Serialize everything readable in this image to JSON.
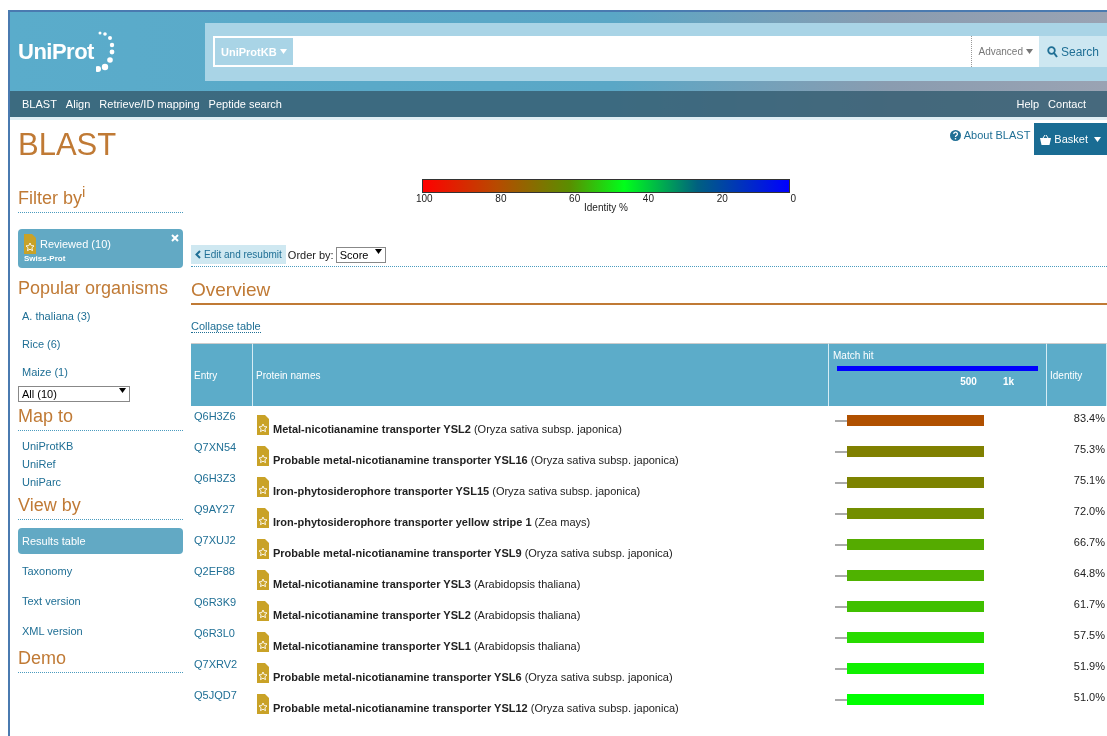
{
  "header": {
    "logo": "UniProt",
    "search": {
      "database": "UniProtKB",
      "advanced": "Advanced",
      "button": "Search"
    },
    "nav_left": [
      "BLAST",
      "Align",
      "Retrieve/ID mapping",
      "Peptide search"
    ],
    "nav_right": [
      "Help",
      "Contact"
    ]
  },
  "page_title": "BLAST",
  "about_link": "About BLAST",
  "basket": "Basket",
  "sidebar": {
    "filter_title": "Filter by$^{i}$",
    "active_filter": {
      "label": "Reviewed (10)",
      "sublabel": "Swiss-Prot"
    },
    "organisms_title": "Popular organisms",
    "organisms": [
      "A. thaliana (3)",
      "Rice (6)",
      "Maize (1)"
    ],
    "organism_select": "All (10)",
    "map_title": "Map to",
    "map_items": [
      "UniProtKB",
      "UniRef",
      "UniParc"
    ],
    "view_title": "View by",
    "view_items": [
      {
        "label": "Results table",
        "selected": true
      },
      {
        "label": "Taxonomy",
        "selected": false
      },
      {
        "label": "Text version",
        "selected": false
      },
      {
        "label": "XML version",
        "selected": false
      }
    ],
    "demo_title": "Demo"
  },
  "legend": {
    "ticks": [
      "100",
      "80",
      "60",
      "40",
      "20",
      "0"
    ],
    "label": "Identity %"
  },
  "toolbar": {
    "edit_button": "Edit and resubmit",
    "order_label": "Order by:",
    "order_select": "Score"
  },
  "overview_title": "Overview",
  "collapse_link": "Collapse table",
  "table": {
    "columns": [
      "Entry",
      "Protein names",
      "Match hit",
      "Identity"
    ],
    "match_ticks": [
      "500",
      "1k"
    ],
    "rows": [
      {
        "entry": "Q6H3Z6",
        "name": "**Metal-nicotianamine transporter YSL2** (Oryza sativa subsp. japonica)",
        "identity": "83.4%",
        "color": "#b05000"
      },
      {
        "entry": "Q7XN54",
        "name": "**Probable metal-nicotianamine transporter YSL16** (Oryza sativa subsp. japonica)",
        "identity": "75.3%",
        "color": "#808000"
      },
      {
        "entry": "Q6H3Z3",
        "name": "**Iron-phytosiderophore transporter YSL15** (Oryza sativa subsp. japonica)",
        "identity": "75.1%",
        "color": "#7d8300"
      },
      {
        "entry": "Q9AY27",
        "name": "**Iron-phytosiderophore transporter yellow stripe 1** (Zea mays)",
        "identity": "72.0%",
        "color": "#738e00"
      },
      {
        "entry": "Q7XUJ2",
        "name": "**Probable metal-nicotianamine transporter YSL9** (Oryza sativa subsp. japonica)",
        "identity": "66.7%",
        "color": "#55ab00"
      },
      {
        "entry": "Q2EF88",
        "name": "**Metal-nicotianamine transporter YSL3** (Arabidopsis thaliana)",
        "identity": "64.8%",
        "color": "#4fb200"
      },
      {
        "entry": "Q6R3K9",
        "name": "**Metal-nicotianamine transporter YSL2** (Arabidopsis thaliana)",
        "identity": "61.7%",
        "color": "#40c000"
      },
      {
        "entry": "Q6R3L0",
        "name": "**Metal-nicotianamine transporter YSL1** (Arabidopsis thaliana)",
        "identity": "57.5%",
        "color": "#28db00"
      },
      {
        "entry": "Q7XRV2",
        "name": "**Probable metal-nicotianamine transporter YSL6** (Oryza sativa subsp. japonica)",
        "identity": "51.9%",
        "color": "#10f000"
      },
      {
        "entry": "Q5JQD7",
        "name": "**Probable metal-nicotianamine transporter YSL12** (Oryza sativa subsp. japonica)",
        "identity": "51.0%",
        "color": "#00ff00"
      }
    ]
  }
}
